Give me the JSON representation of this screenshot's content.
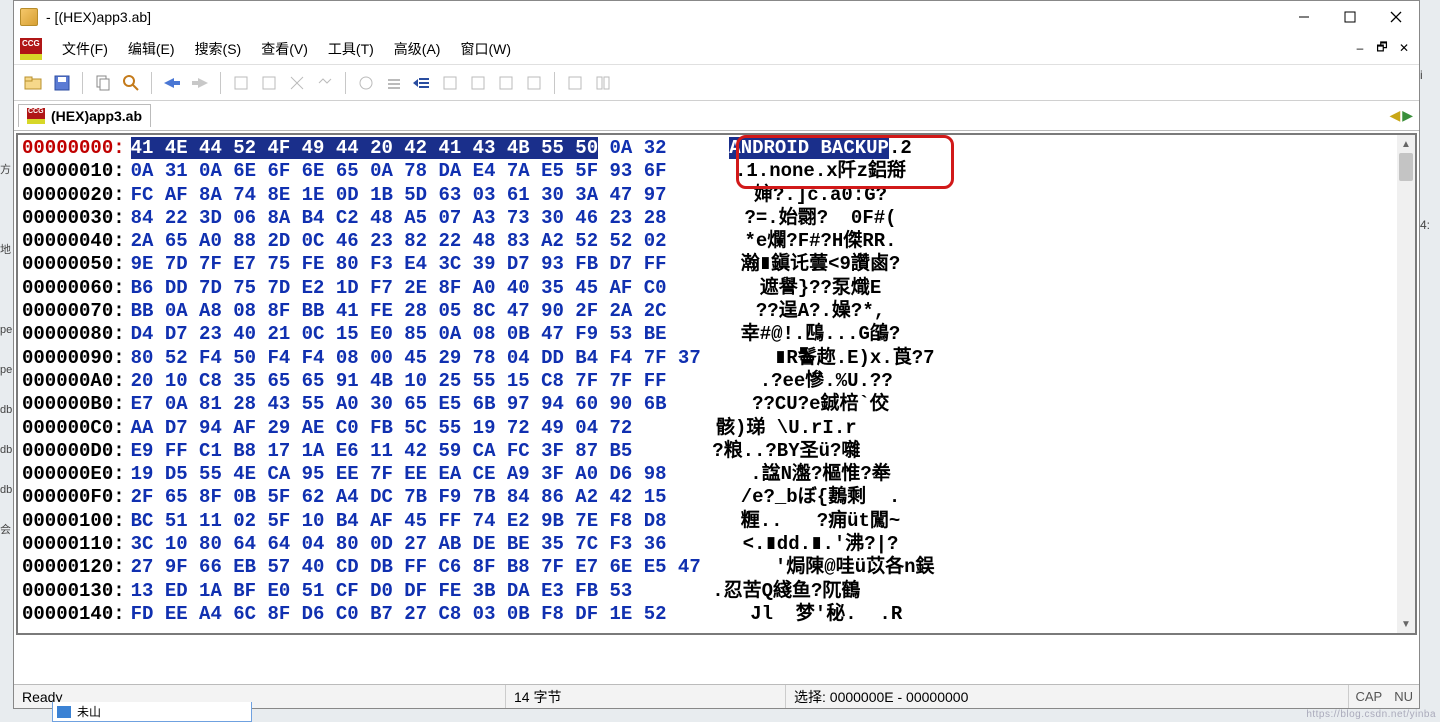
{
  "window": {
    "title": " - [(HEX)app3.ab]"
  },
  "menu": {
    "file": "文件(F)",
    "edit": "编辑(E)",
    "search": "搜索(S)",
    "view": "查看(V)",
    "tools": "工具(T)",
    "adv": "高级(A)",
    "window": "窗口(W)"
  },
  "doc_tab": {
    "label": "(HEX)app3.ab"
  },
  "hex": {
    "selected_hex": "41 4E 44 52 4F 49 44 20 42 41 43 4B 55 50",
    "rows": [
      {
        "addr": "00000000:",
        "rest": " 0A 32",
        "ascii_sel": "ANDROID BACKUP",
        "ascii_rest": ".2"
      },
      {
        "addr": "00000010:",
        "hex": "0A 31 0A 6E 6F 6E 65 0A 78 DA E4 7A E5 5F 93 6F",
        "ascii": ".1.none.x阡z鋁搿"
      },
      {
        "addr": "00000020:",
        "hex": "FC AF 8A 74 8E 1E 0D 1B 5D 63 03 61 30 3A 47 97",
        "ascii": "婶?.]c.a0:G?"
      },
      {
        "addr": "00000030:",
        "hex": "84 22 3D 06 8A B4 C2 48 A5 07 A3 73 30 46 23 28",
        "ascii": "?=.始翾?  0F#("
      },
      {
        "addr": "00000040:",
        "hex": "2A 65 A0 88 2D 0C 46 23 82 22 48 83 A2 52 52 02",
        "ascii": "*e爛?F#?H傑RR."
      },
      {
        "addr": "00000050:",
        "hex": "9E 7D 7F E7 75 FE 80 F3 E4 3C 39 D7 93 FB D7 FF",
        "ascii": "瀚∎鎭讬蕓<9讚鹵?"
      },
      {
        "addr": "00000060:",
        "hex": "B6 DD 7D 75 7D E2 1D F7 2E 8F A0 40 35 45 AF C0",
        "ascii": "遮譽}??泵熾E"
      },
      {
        "addr": "00000070:",
        "hex": "BB 0A A8 08 8F BB 41 FE 28 05 8C 47 90 2F 2A 2C",
        "ascii": "??逞A?.嬠?*,"
      },
      {
        "addr": "00000080:",
        "hex": "D4 D7 23 40 21 0C 15 E0 85 0A 08 0B 47 F9 53 BE",
        "ascii": "幸#@!.鴄...G鵮?"
      },
      {
        "addr": "00000090:",
        "hex": "80 52 F4 50 F4 F4 08 00 45 29 78 04 DD B4 F4 7F 37",
        "ascii": "∎R鬠趂.E)x.莨?7"
      },
      {
        "addr": "000000A0:",
        "hex": "20 10 C8 35 65 65 91 4B 10 25 55 15 C8 7F 7F FF",
        "ascii": " .?ee慘.%U.??"
      },
      {
        "addr": "000000B0:",
        "hex": "E7 0A 81 28 43 55 A0 30 65 E5 6B 97 94 60 90 6B",
        "ascii": "??CU?e鋮棓`佼"
      },
      {
        "addr": "000000C0:",
        "hex": "AA D7 94 AF 29 AE C0 FB 5C 55 19 72 49 04 72",
        "ascii": "骸)珶 \\U.rI.r"
      },
      {
        "addr": "000000D0:",
        "hex": "E9 FF C1 B8 17 1A E6 11 42 59 CA FC 3F 87 B5",
        "ascii": "?粮..?BY圣ü?囃"
      },
      {
        "addr": "000000E0:",
        "hex": "19 D5 55 4E CA 95 EE 7F EE EA CE A9 3F A0 D6 98",
        "ascii": ".諡N瀊?樞惟?牶"
      },
      {
        "addr": "000000F0:",
        "hex": "2F 65 8F 0B 5F 62 A4 DC 7B F9 7B 84 86 A2 42 15",
        "ascii": "/e?_bぼ{鶈剩  ."
      },
      {
        "addr": "00000100:",
        "hex": "BC 51 11 02 5F 10 B4 AF 45 FF 74 E2 9B 7E F8 D8",
        "ascii": "糎..   ?痈üt闖~"
      },
      {
        "addr": "00000110:",
        "hex": "3C 10 80 64 64 04 80 0D 27 AB DE BE 35 7C F3 36",
        "ascii": "<.∎dd.∎.'沸?|?"
      },
      {
        "addr": "00000120:",
        "hex": "27 9F 66 EB 57 40 CD DB FF C6 8F B8 7F E7 6E E5 47",
        "ascii": "'焗陳@哇ü苡各n鋘"
      },
      {
        "addr": "00000130:",
        "hex": "13 ED 1A BF E0 51 CF D0 DF FE 3B DA E3 FB 53",
        "ascii": ".忍苦Q綫鱼?阢鶴"
      },
      {
        "addr": "00000140:",
        "hex": "FD EE A4 6C 8F D6 C0 B7 27 C8 03 0B F8 DF 1E 52",
        "ascii": " Jl  梦'秘.  .R"
      }
    ]
  },
  "status": {
    "ready": "Ready",
    "bytes": "14 字节",
    "selection": "选择: 0000000E - 00000000",
    "cap": "CAP",
    "nu": "NU"
  },
  "desk": {
    "label": "未山"
  },
  "watermark": "https://blog.csdn.net/yinba"
}
